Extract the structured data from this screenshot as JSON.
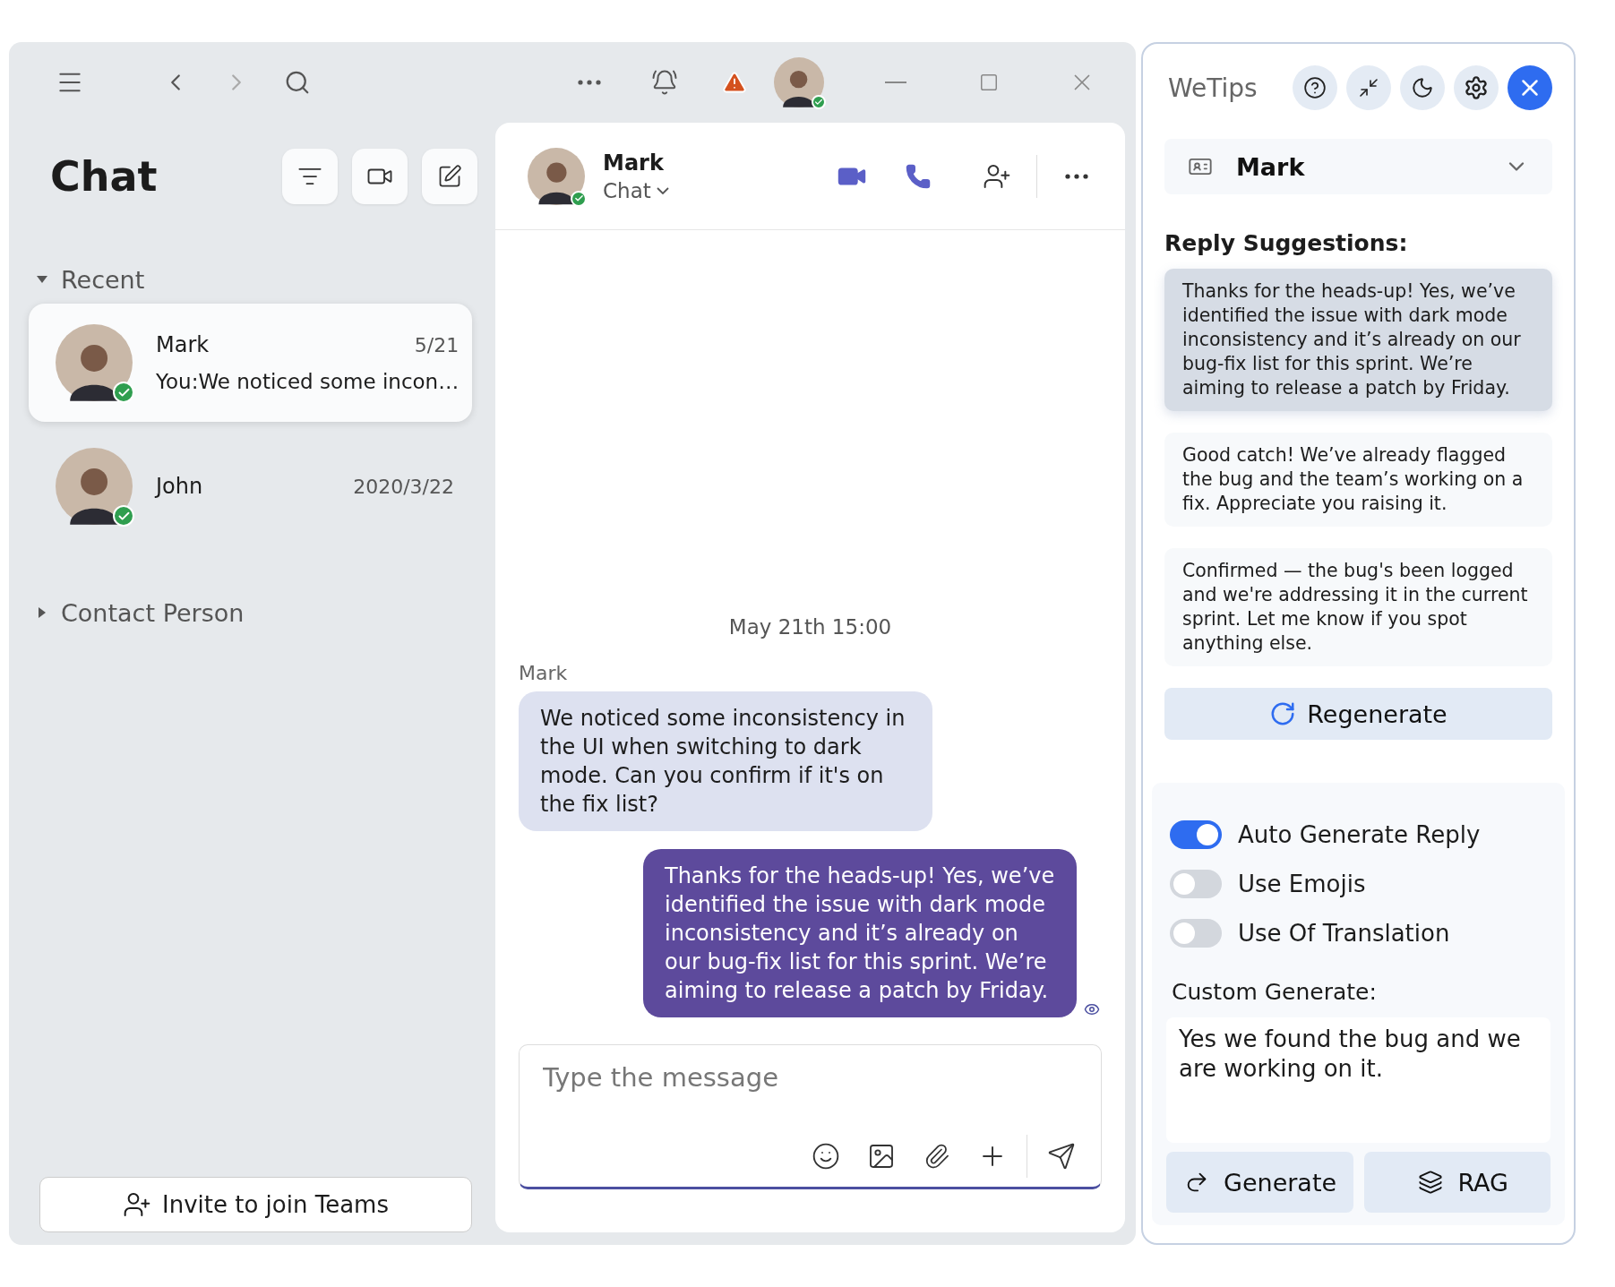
{
  "titlebar": {
    "user_online": true
  },
  "sidebar": {
    "title": "Chat",
    "sections": [
      {
        "label": "Recent",
        "expanded": true,
        "chats": [
          {
            "name": "Mark",
            "date": "5/21",
            "preview": "You:We noticed some incon…",
            "selected": true,
            "online": true
          },
          {
            "name": "John",
            "date": "2020/3/22",
            "selected": false,
            "online": true
          }
        ]
      },
      {
        "label": "Contact Person",
        "expanded": false
      }
    ],
    "invite_button": "Invite to join Teams"
  },
  "conversation": {
    "contact": "Mark",
    "subtitle": "Chat",
    "online": true,
    "date_divider": "May 21th 15:00",
    "messages": [
      {
        "kind": "incoming",
        "sender": "Mark",
        "text": "We noticed some inconsistency in the UI when switching to dark mode. Can you confirm if it's on the fix list?"
      },
      {
        "kind": "outgoing",
        "text": "Thanks for the heads-up! Yes, we’ve identified the issue with dark mode inconsistency and it’s already on our bug-fix list for this sprint. We’re aiming to release a patch by Friday.",
        "seen": true
      }
    ],
    "composer": {
      "placeholder": "Type the message"
    }
  },
  "wetips": {
    "title": "WeTips",
    "contact": "Mark",
    "heading": "Reply Suggestions:",
    "suggestions": [
      {
        "text": "Thanks for the heads-up! Yes, we’ve identified the issue with dark mode inconsistency and it’s already on our bug-fix list for this sprint. We’re aiming to release a patch by Friday.",
        "selected": true
      },
      {
        "text": "Good catch! We’ve already flagged the bug and the team’s working on a fix. Appreciate you raising it.",
        "selected": false
      },
      {
        "text": "Confirmed — the bug's been logged and we're addressing it in the current sprint. Let me know if you spot anything else.",
        "selected": false
      }
    ],
    "regenerate": "Regenerate",
    "toggles": [
      {
        "label": "Auto Generate Reply",
        "on": true
      },
      {
        "label": "Use Emojis",
        "on": false
      },
      {
        "label": "Use Of Translation",
        "on": false
      }
    ],
    "custom_label": "Custom Generate:",
    "custom_value": "Yes we found the bug and we are working on it.",
    "buttons": [
      {
        "kind": "generate",
        "label": "Generate"
      },
      {
        "kind": "rag",
        "label": "RAG"
      }
    ]
  }
}
